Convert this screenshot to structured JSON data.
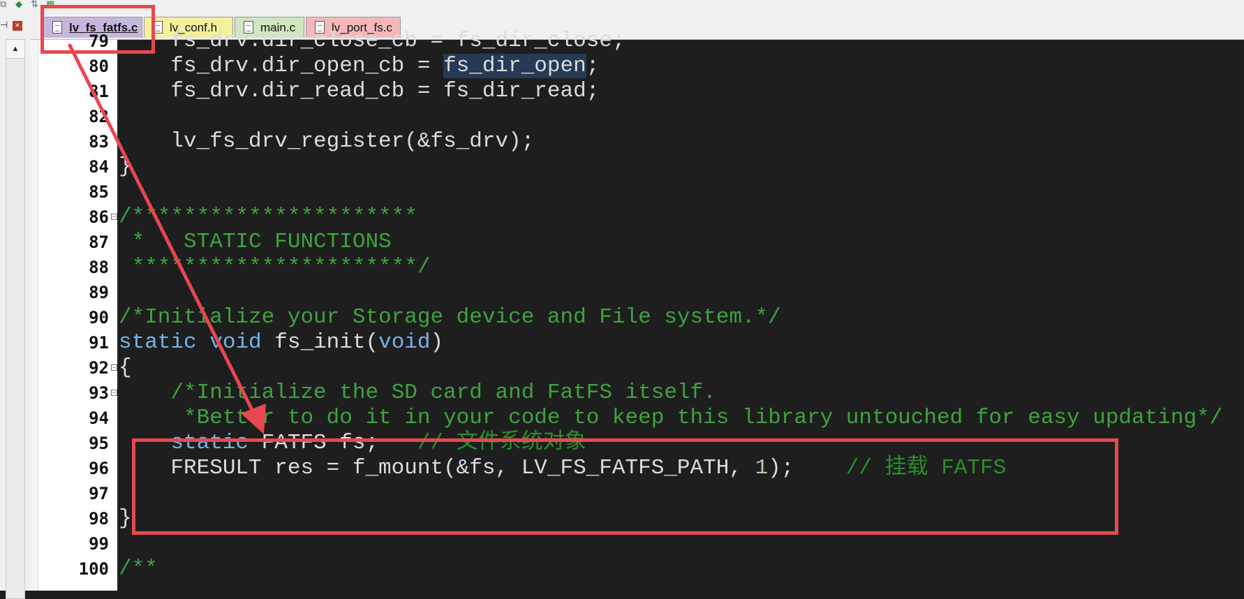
{
  "tabs": [
    {
      "label": "lv_fs_fatfs.c",
      "active": true,
      "color": "#c7b7df"
    },
    {
      "label": "lv_conf.h",
      "active": false,
      "color": "#f6ef9c"
    },
    {
      "label": "main.c",
      "active": false,
      "color": "#cfe6be"
    },
    {
      "label": "lv_port_fs.c",
      "active": false,
      "color": "#f3b9b9"
    }
  ],
  "icons": {
    "toolbar": [
      "copy-icon",
      "diamond-icon",
      "step-icon",
      "build-icon"
    ],
    "panel": [
      "pin-icon",
      "close-icon"
    ],
    "scroll": "up-arrow-icon"
  },
  "colors": {
    "annotation": "#e8484f",
    "keyword": "#73b3e8",
    "comment": "#3ea33e",
    "editor_background": "#1e1e1e"
  },
  "code": {
    "lines": [
      {
        "n": "79",
        "segs": [
          [
            "",
            "    fs_drv.dir_close_cb = fs_dir_close;"
          ]
        ]
      },
      {
        "n": "80",
        "segs": [
          [
            "",
            "    fs_drv.dir_open_cb = "
          ],
          [
            "hl",
            "fs_dir_open"
          ],
          [
            "",
            ";"
          ]
        ]
      },
      {
        "n": "81",
        "segs": [
          [
            "",
            "    fs_drv.dir_read_cb = fs_dir_read;"
          ]
        ]
      },
      {
        "n": "82",
        "segs": []
      },
      {
        "n": "83",
        "segs": [
          [
            "",
            "    lv_fs_drv_register(&fs_drv);"
          ]
        ]
      },
      {
        "n": "84",
        "segs": [
          [
            "",
            "}"
          ]
        ]
      },
      {
        "n": "85",
        "segs": []
      },
      {
        "n": "86",
        "fold": true,
        "segs": [
          [
            "cmt",
            "/**********************"
          ]
        ]
      },
      {
        "n": "87",
        "segs": [
          [
            "cmt",
            " *   STATIC FUNCTIONS"
          ]
        ]
      },
      {
        "n": "88",
        "segs": [
          [
            "cmt",
            " **********************/"
          ]
        ]
      },
      {
        "n": "89",
        "segs": []
      },
      {
        "n": "90",
        "segs": [
          [
            "cmt",
            "/*Initialize your Storage device and File system.*/"
          ]
        ]
      },
      {
        "n": "91",
        "segs": [
          [
            "kw",
            "static"
          ],
          [
            "",
            " "
          ],
          [
            "kw",
            "void"
          ],
          [
            "",
            " fs_init("
          ],
          [
            "kw",
            "void"
          ],
          [
            "",
            ")"
          ]
        ]
      },
      {
        "n": "92",
        "fold": true,
        "segs": [
          [
            "",
            "{"
          ]
        ]
      },
      {
        "n": "93",
        "fold": true,
        "segs": [
          [
            "",
            "    "
          ],
          [
            "cmt",
            "/*Initialize the SD card and FatFS itself."
          ]
        ]
      },
      {
        "n": "94",
        "segs": [
          [
            "cmt",
            "     *Better to do it in your code to keep this library untouched for easy updating*/"
          ]
        ]
      },
      {
        "n": "95",
        "segs": [
          [
            "",
            "    "
          ],
          [
            "kw",
            "static"
          ],
          [
            "",
            " FATFS fs;   "
          ],
          [
            "cmtcn",
            "// 文件系统对象"
          ]
        ]
      },
      {
        "n": "96",
        "segs": [
          [
            "",
            "    FRESULT res = f_mount(&fs, LV_FS_FATFS_PATH, "
          ],
          [
            "num",
            "1"
          ],
          [
            "",
            ");    "
          ],
          [
            "cmtcn",
            "// 挂载 FATFS"
          ]
        ]
      },
      {
        "n": "97",
        "segs": []
      },
      {
        "n": "98",
        "segs": [
          [
            "",
            "}"
          ]
        ]
      },
      {
        "n": "99",
        "segs": []
      },
      {
        "n": "100",
        "segs": [
          [
            "cmt",
            "/**"
          ]
        ]
      }
    ]
  }
}
